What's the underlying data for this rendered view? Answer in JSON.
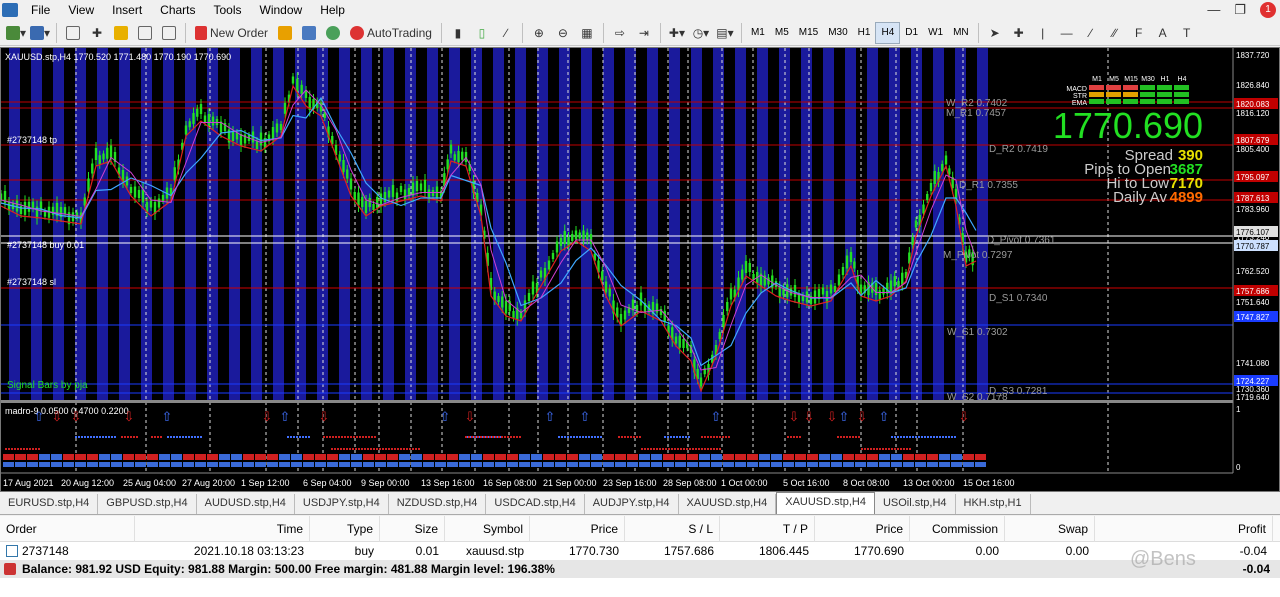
{
  "menu": [
    "File",
    "View",
    "Insert",
    "Charts",
    "Tools",
    "Window",
    "Help"
  ],
  "toolbar": {
    "new_order": "New Order",
    "autotrading": "AutoTrading",
    "timeframes": [
      "M1",
      "M5",
      "M15",
      "M30",
      "H1",
      "H4",
      "D1",
      "W1",
      "MN"
    ],
    "active_timeframe": "H4"
  },
  "chart": {
    "header": "XAUUSD.stp,H4  1770.520 1771.480 1770.190 1770.690",
    "big_price": "1770.690",
    "spread_label": "Spread",
    "spread_value": "390",
    "pips_label": "Pips to Open",
    "pips_value": "3687",
    "hilo_label": "Hi to Low",
    "hilo_value": "7170",
    "daily_label": "Daily Av",
    "daily_value": "4899",
    "mtf_headers": [
      "M1",
      "M5",
      "M15",
      "M30",
      "H1",
      "H4"
    ],
    "mtf_rows": [
      "MACD",
      "STR",
      "EMA"
    ],
    "order_tp": "#2737148 tp",
    "order_buy": "#2737148 buy 0.01",
    "order_sl": "#2737148 sl",
    "signal_label": "Signal Bars by pja",
    "indicator_label": "madro-9 0.0500 0.4700 0.2200",
    "pivot_labels": [
      {
        "text": "W_R2 0.7402"
      },
      {
        "text": "M_R1 0.7457"
      },
      {
        "text": "D_R2 0.7419"
      },
      {
        "text": "D_R1 0.7355"
      },
      {
        "text": "D_Pivot 0.7361"
      },
      {
        "text": "M_Pivot 0.7297"
      },
      {
        "text": "D_S1 0.7340"
      },
      {
        "text": "W_S1 0.7302"
      },
      {
        "text": "D_S3 0.7281"
      },
      {
        "text": "W_S2 0.7178"
      }
    ],
    "price_scale": [
      "1837.720",
      "1826.840",
      "1816.120",
      "1805.400",
      "1794.600",
      "1783.960",
      "1773.240",
      "1762.520",
      "1751.640",
      "1741.080",
      "1730.360",
      "1719.640"
    ],
    "price_tags": [
      {
        "value": "1820.083",
        "color": "#c00000"
      },
      {
        "value": "1807.679",
        "color": "#c00000"
      },
      {
        "value": "1795.097",
        "color": "#c00000"
      },
      {
        "value": "1787.613",
        "color": "#c00000"
      },
      {
        "value": "1776.107",
        "color": "#e0e0e0"
      },
      {
        "value": "1770.787",
        "color": "#cce0ff"
      },
      {
        "value": "1757.686",
        "color": "#c00000"
      },
      {
        "value": "1747.827",
        "color": "#1a3cff"
      },
      {
        "value": "1724.227",
        "color": "#1a3cff"
      }
    ],
    "sub_scale_top": "1",
    "sub_scale_bottom": "0",
    "time_labels": [
      "17 Aug 2021",
      "20 Aug 12:00",
      "25 Aug 04:00",
      "27 Aug 20:00",
      "1 Sep 12:00",
      "6 Sep 04:00",
      "9 Sep 00:00",
      "13 Sep 16:00",
      "16 Sep 08:00",
      "21 Sep 00:00",
      "23 Sep 16:00",
      "28 Sep 08:00",
      "1 Oct 00:00",
      "5 Oct 16:00",
      "8 Oct 08:00",
      "13 Oct 00:00",
      "15 Oct 16:00"
    ]
  },
  "tabs": [
    "EURUSD.stp,H4",
    "GBPUSD.stp,H4",
    "AUDUSD.stp,H4",
    "USDJPY.stp,H4",
    "NZDUSD.stp,H4",
    "USDCAD.stp,H4",
    "AUDJPY.stp,H4",
    "XAUUSD.stp,H4",
    "XAUUSD.stp,H4",
    "USOil.stp,H4",
    "HKH.stp,H1"
  ],
  "active_tab": 8,
  "terminal": {
    "headers": [
      "Order",
      "Time",
      "Type",
      "Size",
      "Symbol",
      "Price",
      "S / L",
      "T / P",
      "Price",
      "Commission",
      "Swap",
      "Profit"
    ],
    "row": [
      "2737148",
      "2021.10.18 03:13:23",
      "buy",
      "0.01",
      "xauusd.stp",
      "1770.730",
      "1757.686",
      "1806.445",
      "1770.690",
      "0.00",
      "0.00",
      "-0.04"
    ],
    "balance": "Balance: 981.92 USD  Equity: 981.88  Margin: 500.00  Free margin: 481.88  Margin level: 196.38%",
    "balance_profit": "-0.04"
  },
  "watermark": "@Bens"
}
